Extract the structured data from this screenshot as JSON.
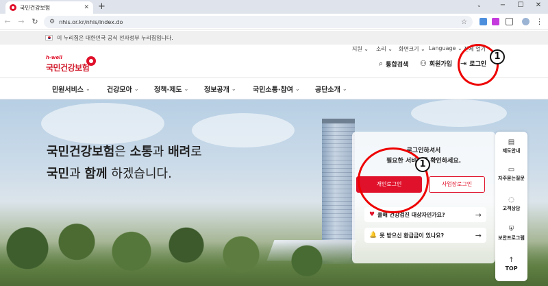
{
  "browser": {
    "tab_title": "국민건강보험",
    "tab_close": "✕",
    "new_tab": "+",
    "url": "nhis.or.kr/nhis/index.do",
    "window_controls": [
      "−",
      "☐",
      "✕"
    ]
  },
  "gov_banner": {
    "text": "이 누리집은 대한민국 공식 전자정부 누리집입니다."
  },
  "utility_nav": [
    "지원",
    "소리",
    "화면크기",
    "Language",
    "전체 열기"
  ],
  "logo": {
    "small": "h-well",
    "text": "국민건강보험"
  },
  "header_buttons": {
    "search": "통합검색",
    "join": "회원가입",
    "login": "로그인"
  },
  "gnb": [
    "민원서비스",
    "건강모아",
    "정책·제도",
    "정보공개",
    "국민소통·참여",
    "공단소개"
  ],
  "hero": {
    "line1": {
      "a": "국민건강보험",
      "b": "은 ",
      "c": "소통",
      "d": "과 ",
      "e": "배려",
      "f": "로"
    },
    "line2": {
      "a": "국민",
      "b": "과 ",
      "c": "함께",
      "d": " 하겠습니다."
    }
  },
  "login_panel": {
    "line1": "로그인하셔서",
    "line2": "필요한 서비스를 확인하세요.",
    "personal_login": "개인로그인",
    "business_login": "사업장로그인",
    "cards": [
      {
        "text": "올해 건강검진 대상자인가요?",
        "arrow": "→"
      },
      {
        "text": "못 받으신 환급금이 있나요?",
        "arrow": "→"
      }
    ]
  },
  "quick_menu": [
    "제도안내",
    "자주묻는질문",
    "고객상담",
    "보안프로그램",
    "TOP"
  ],
  "annotations": [
    "1",
    "1"
  ],
  "colors": {
    "brand": "#e0112b",
    "annotation": "#e00000"
  }
}
